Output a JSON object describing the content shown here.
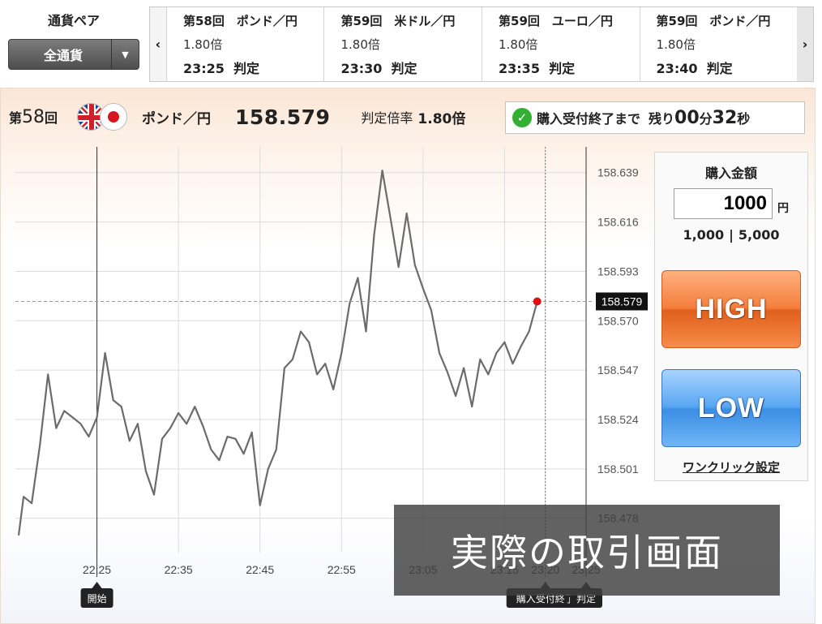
{
  "pair_select": {
    "title": "通貨ペア",
    "value": "全通貨",
    "arrow": "▼"
  },
  "rounds": [
    {
      "title": "第58回　ポンド／円",
      "rate": "1.80倍",
      "time": "23:25  判定"
    },
    {
      "title": "第59回　米ドル／円",
      "rate": "1.80倍",
      "time": "23:30  判定"
    },
    {
      "title": "第59回　ユーロ／円",
      "rate": "1.80倍",
      "time": "23:35  判定"
    },
    {
      "title": "第59回　ポンド／円",
      "rate": "1.80倍",
      "time": "23:40  判定"
    }
  ],
  "nav": {
    "prev": "‹",
    "next": "›"
  },
  "info": {
    "round_prefix": "第",
    "round_num": "58",
    "round_suffix": "回",
    "pair": "ポンド／円",
    "price": "158.579",
    "rate_label": "判定倍率",
    "rate": "1.80倍",
    "status_check": "✓",
    "status_label": "購入受付終了まで",
    "remaining_label": "残り",
    "minutes": "00",
    "minutes_unit": "分",
    "seconds": "32",
    "seconds_unit": "秒"
  },
  "trade": {
    "amount_label": "購入金額",
    "amount": "1000",
    "unit": "円",
    "preset1": "1,000",
    "preset_sep": "|",
    "preset2": "5,000",
    "high": "HIGH",
    "low": "LOW",
    "oneclick": "ワンクリック設定"
  },
  "overlay_text": "実際の取引画面",
  "colors": {
    "line": "#6b6b6b",
    "marker": "#e01010",
    "high": "#f47f3e",
    "low": "#3b8ee4"
  },
  "chart_data": {
    "type": "line",
    "y_ticks": [
      "158.639",
      "158.616",
      "158.593",
      "158.570",
      "158.547",
      "158.524",
      "158.501",
      "158.478"
    ],
    "ylim": [
      158.462,
      158.651
    ],
    "x_ticks": [
      "22:25",
      "22:35",
      "22:45",
      "22:55",
      "23:05",
      "23:15",
      "23:20",
      "23:25"
    ],
    "x_tick_minutes": [
      0,
      10,
      20,
      30,
      40,
      50,
      55,
      60
    ],
    "xlim_minutes": [
      -10,
      60
    ],
    "current_price": "158.579",
    "current_minute": 54,
    "markers": [
      {
        "label": "開始",
        "minute": 0
      },
      {
        "label": "購入受付終了",
        "minute": 55
      },
      {
        "label": "判定",
        "minute": 60
      }
    ],
    "series": [
      {
        "x": [
          -9.6,
          -9,
          -8,
          -7,
          -6,
          -5,
          -4,
          -3,
          -2,
          -1,
          0,
          1,
          2,
          3,
          4,
          5,
          6,
          7,
          8,
          9,
          10,
          11,
          12,
          13,
          14,
          15,
          16,
          17,
          18,
          19,
          20,
          21,
          22,
          23,
          24,
          25,
          26,
          27,
          28,
          29,
          30,
          31,
          32,
          33,
          34,
          35,
          36,
          37,
          38,
          39,
          40,
          41,
          42,
          43,
          44,
          45,
          46,
          47,
          48,
          49,
          50,
          51,
          52,
          53,
          54
        ],
        "y": [
          158.47,
          158.488,
          158.485,
          158.512,
          158.545,
          158.52,
          158.528,
          158.525,
          158.522,
          158.516,
          158.525,
          158.555,
          158.533,
          158.53,
          158.514,
          158.522,
          158.5,
          158.489,
          158.515,
          158.52,
          158.527,
          158.522,
          158.53,
          158.521,
          158.51,
          158.505,
          158.516,
          158.515,
          158.508,
          158.518,
          158.484,
          158.501,
          158.51,
          158.548,
          158.552,
          158.565,
          158.56,
          158.545,
          158.55,
          158.538,
          158.555,
          158.578,
          158.59,
          158.565,
          158.61,
          158.64,
          158.618,
          158.595,
          158.62,
          158.596,
          158.585,
          158.575,
          158.555,
          158.546,
          158.535,
          158.548,
          158.53,
          158.552,
          158.545,
          158.555,
          158.56,
          158.55,
          158.558,
          158.565,
          158.579
        ]
      }
    ]
  }
}
